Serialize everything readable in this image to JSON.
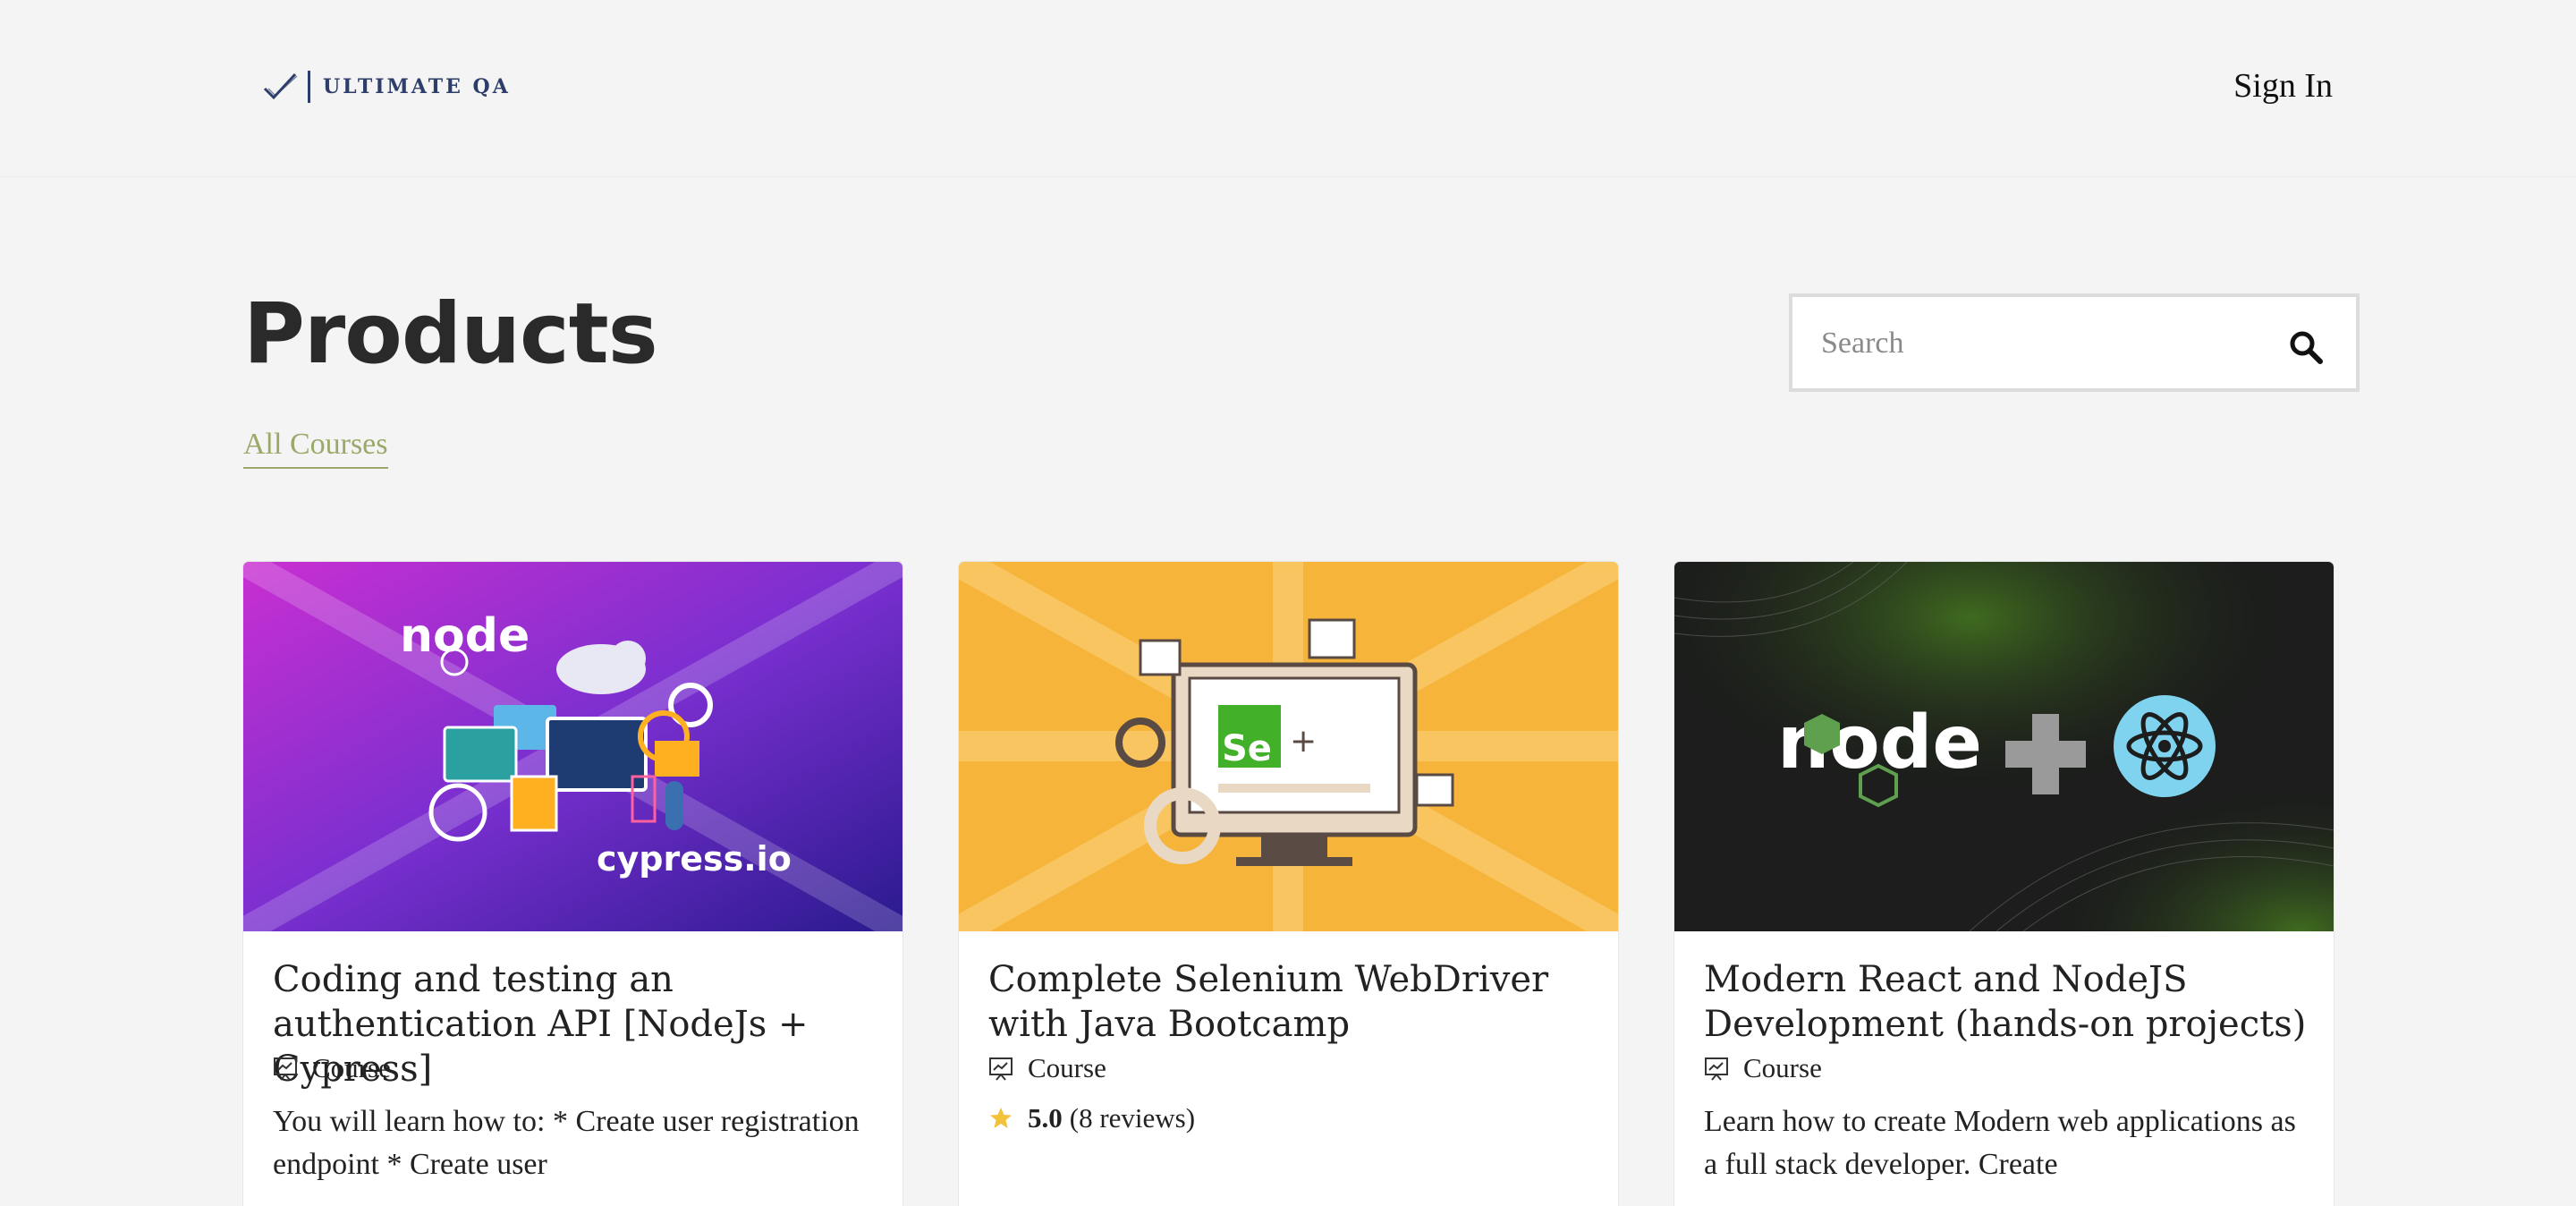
{
  "header": {
    "logo_text": "ULTIMATE QA",
    "sign_in_label": "Sign In"
  },
  "page": {
    "title": "Products",
    "tab_label": "All Courses"
  },
  "search": {
    "placeholder": "Search",
    "value": ""
  },
  "products": [
    {
      "title": "Coding and testing an authentication API [NodeJs + Cypress]",
      "type": "Course",
      "description": "You will learn how to: * Create user registration endpoint * Create user",
      "image_labels": {
        "brand_top": "node",
        "brand_bottom": "cypress.io"
      }
    },
    {
      "title": "Complete Selenium WebDriver with Java Bootcamp",
      "type": "Course",
      "rating_score": "5.0",
      "rating_reviews": "(8 reviews)",
      "image_labels": {
        "logo": "Se"
      }
    },
    {
      "title": "Modern React and NodeJS Development (hands-on projects)",
      "type": "Course",
      "description": "Learn how to create Modern web applications as a full stack developer. Create",
      "image_labels": {
        "brand": "node"
      }
    }
  ],
  "colors": {
    "page_bg": "#f4f4f4",
    "tab_accent": "#9aa96a",
    "logo_navy": "#2d3e6b",
    "star": "#f3c13a"
  },
  "icons": [
    "logo-check-icon",
    "search-icon",
    "course-icon",
    "star-icon"
  ]
}
